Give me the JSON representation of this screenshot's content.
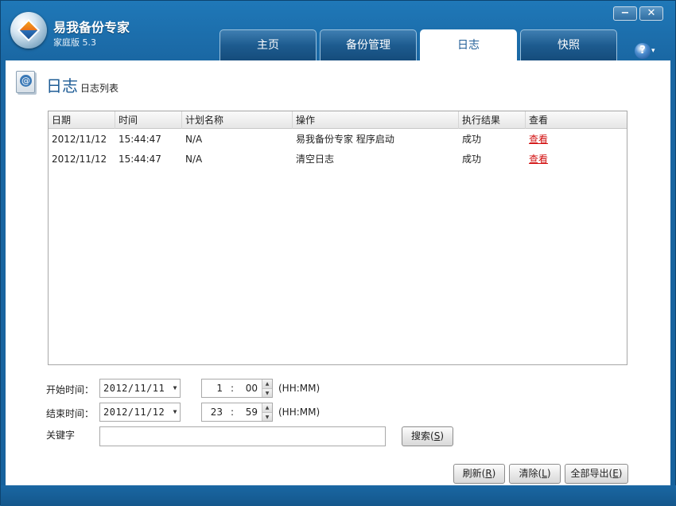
{
  "app": {
    "title": "易我备份专家",
    "version": "家庭版 5.3"
  },
  "window_controls": {
    "minimize": "−",
    "close": "✕"
  },
  "tabs": [
    {
      "label": "主页",
      "active": false
    },
    {
      "label": "备份管理",
      "active": false
    },
    {
      "label": "日志",
      "active": true
    },
    {
      "label": "快照",
      "active": false
    }
  ],
  "help": {
    "label": "?",
    "caret": "▾"
  },
  "page": {
    "title": "日志",
    "subtitle": "日志列表",
    "icon": "@"
  },
  "table": {
    "columns": [
      "日期",
      "时间",
      "计划名称",
      "操作",
      "执行结果",
      "查看"
    ],
    "rows": [
      {
        "date": "2012/11/12",
        "time": "15:44:47",
        "plan": "N/A",
        "action": "易我备份专家 程序启动",
        "result": "成功",
        "view": "查看"
      },
      {
        "date": "2012/11/12",
        "time": "15:44:47",
        "plan": "N/A",
        "action": "清空日志",
        "result": "成功",
        "view": "查看"
      }
    ]
  },
  "filters": {
    "start_label": "开始时间：",
    "start_date": "2012/11/11",
    "start_hour": "1",
    "start_min": "00",
    "end_label": "结束时间：",
    "end_date": "2012/11/12",
    "end_hour": "23",
    "end_min": "59",
    "time_sep": ":",
    "unit": "(HH:MM)",
    "keyword_label": "关键字",
    "keyword_value": ""
  },
  "buttons": {
    "search": {
      "text": "搜索(",
      "key": "S",
      "close": ")"
    },
    "refresh": {
      "text": "刷新(",
      "key": "R",
      "close": ")"
    },
    "clear": {
      "text": "清除(",
      "key": "L",
      "close": ")"
    },
    "export": {
      "text": "全部导出(",
      "key": "E",
      "close": ")"
    }
  }
}
